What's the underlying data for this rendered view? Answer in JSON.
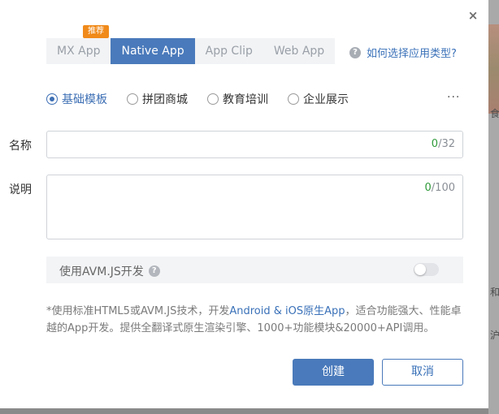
{
  "background": {
    "side_text_1": "食",
    "side_text_2": "和",
    "side_text_3": "沪"
  },
  "dialog": {
    "close_symbol": "×",
    "badge": "推荐",
    "tabs": [
      {
        "label": "MX App",
        "active": false
      },
      {
        "label": "Native App",
        "active": true
      },
      {
        "label": "App Clip",
        "active": false
      },
      {
        "label": "Web App",
        "active": false
      }
    ],
    "help_icon": "?",
    "help_link": "如何选择应用类型?",
    "templates": [
      {
        "label": "基础模板",
        "checked": true
      },
      {
        "label": "拼团商城",
        "checked": false
      },
      {
        "label": "教育培训",
        "checked": false
      },
      {
        "label": "企业展示",
        "checked": false
      }
    ],
    "more": "···",
    "name_field": {
      "label": "名称",
      "value": "",
      "count": "0",
      "max": "/32"
    },
    "desc_field": {
      "label": "说明",
      "value": "",
      "count": "0",
      "max": "/100"
    },
    "avm_toggle": {
      "label": "使用AVM.JS开发",
      "help_icon": "?",
      "enabled": false
    },
    "description": {
      "part1": "*使用标准HTML5或AVM.JS技术，开发",
      "highlight": "Android & iOS原生App",
      "part2": "，适合功能强大、性能卓越的App开发。提供全翻译式原生渲染引擎、1000+功能模块&20000+API调用。"
    },
    "create_button": "创建",
    "cancel_button": "取消"
  },
  "colors": {
    "accent": "#4a7abb",
    "badge": "#f08a1a",
    "link": "#3a71b8",
    "counter_green": "#2e9a3a"
  }
}
